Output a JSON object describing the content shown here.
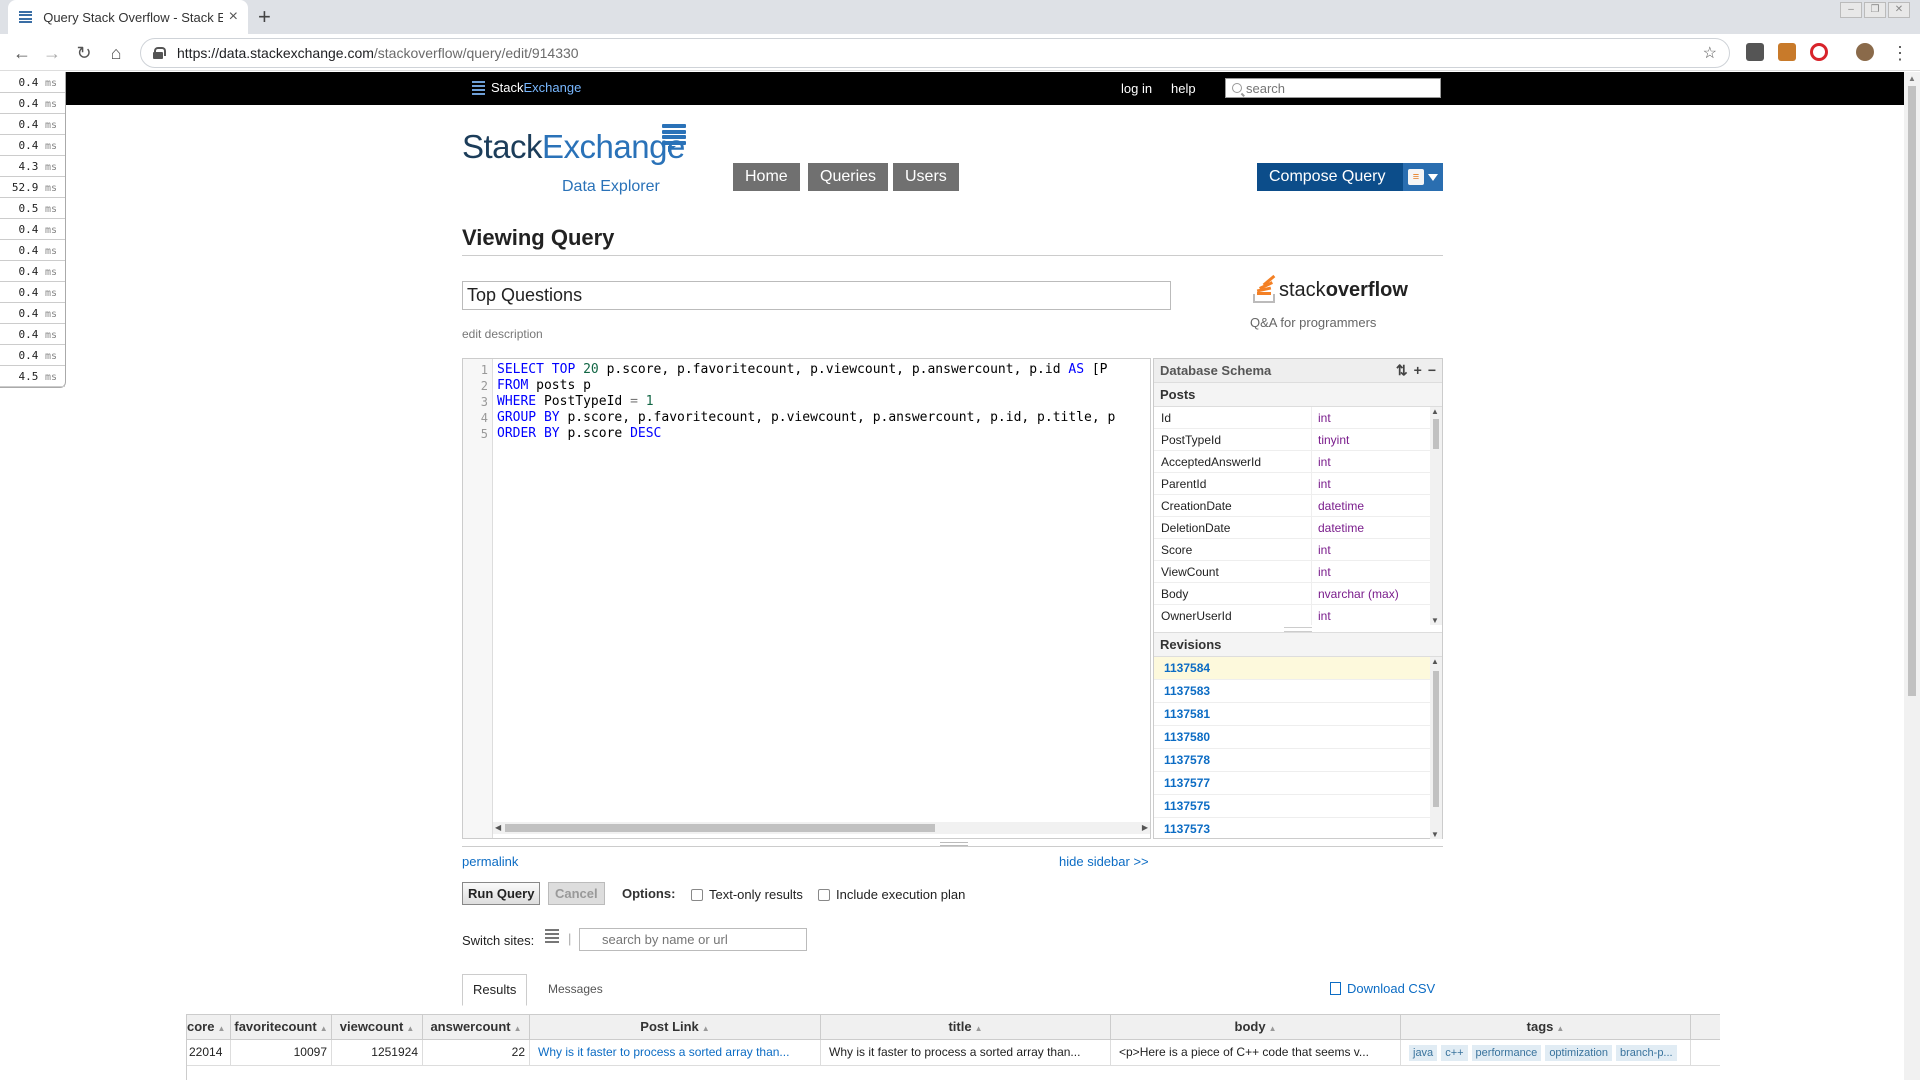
{
  "browser": {
    "tab_title": "Query Stack Overflow - Stack Ex",
    "url_host": "https://data.stackexchange.com",
    "url_path": "/stackoverflow/query/edit/914330"
  },
  "timings": [
    "0.4",
    "0.4",
    "0.4",
    "0.4",
    "4.3",
    "52.9",
    "0.5",
    "0.4",
    "0.4",
    "0.4",
    "0.4",
    "0.4",
    "0.4",
    "0.4",
    "4.5"
  ],
  "timing_unit": "ms",
  "topbar": {
    "brand_a": "Stack",
    "brand_b": "Exchange",
    "login": "log in",
    "help": "help",
    "search_placeholder": "search"
  },
  "header": {
    "logo_a": "Stack",
    "logo_b": "Exchange",
    "logo_sub": "Data Explorer",
    "nav": [
      "Home",
      "Queries",
      "Users"
    ],
    "compose": "Compose Query"
  },
  "page": {
    "heading": "Viewing Query",
    "query_title": "Top Questions",
    "edit_description": "edit description",
    "site_name_a": "stack",
    "site_name_b": "overflow",
    "site_tagline": "Q&A for programmers"
  },
  "editor": {
    "line_numbers": [
      "1",
      "2",
      "3",
      "4",
      "5"
    ]
  },
  "sidebar": {
    "title": "Database Schema",
    "table": "Posts",
    "columns": [
      {
        "name": "Id",
        "type": "int"
      },
      {
        "name": "PostTypeId",
        "type": "tinyint"
      },
      {
        "name": "AcceptedAnswerId",
        "type": "int"
      },
      {
        "name": "ParentId",
        "type": "int"
      },
      {
        "name": "CreationDate",
        "type": "datetime"
      },
      {
        "name": "DeletionDate",
        "type": "datetime"
      },
      {
        "name": "Score",
        "type": "int"
      },
      {
        "name": "ViewCount",
        "type": "int"
      },
      {
        "name": "Body",
        "type": "nvarchar (max)"
      },
      {
        "name": "OwnerUserId",
        "type": "int"
      }
    ],
    "revisions_title": "Revisions",
    "revisions": [
      "1137584",
      "1137583",
      "1137581",
      "1137580",
      "1137578",
      "1137577",
      "1137575",
      "1137573"
    ]
  },
  "controls": {
    "permalink": "permalink",
    "hide_sidebar": "hide sidebar >>",
    "run": "Run Query",
    "cancel": "Cancel",
    "options_label": "Options:",
    "opt_text_only": "Text-only results",
    "opt_exec_plan": "Include execution plan",
    "switch_label": "Switch sites:",
    "switch_placeholder": "search by name or url"
  },
  "results": {
    "tab_results": "Results",
    "tab_messages": "Messages",
    "download_csv": "Download CSV",
    "headers": [
      "core",
      "favoritecount",
      "viewcount",
      "answercount",
      "Post Link",
      "title",
      "body",
      "tags"
    ],
    "row1": {
      "score": "22014",
      "favoritecount": "10097",
      "viewcount": "1251924",
      "answercount": "22",
      "post_link": "Why is it faster to process a sorted array than...",
      "title": "Why is it faster to process a sorted array than...",
      "body": "<p>Here is a piece of C++ code that seems v...",
      "tags": [
        "java",
        "c++",
        "performance",
        "optimization",
        "branch-p..."
      ]
    }
  }
}
